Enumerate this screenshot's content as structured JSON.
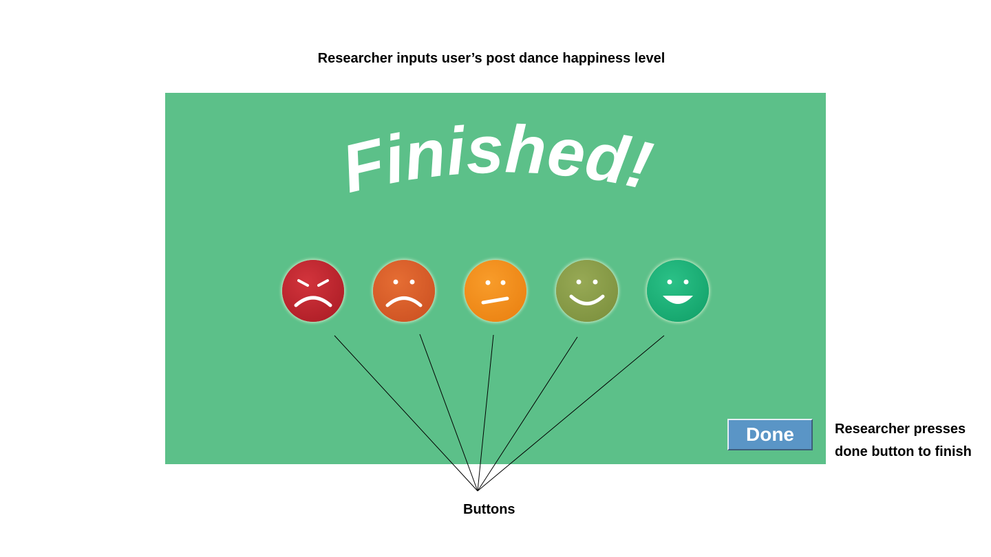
{
  "annotations": {
    "top_caption": "Researcher inputs user’s post dance happiness level",
    "done_caption_line1": "Researcher presses",
    "done_caption_line2": "done button to finish",
    "buttons_caption": "Buttons"
  },
  "screen": {
    "background_color": "#5cc089",
    "title": "Finished!",
    "done_label": "Done",
    "rating_faces": [
      {
        "mood": "angry",
        "color": "#c3262f",
        "icon": "angry-face-icon"
      },
      {
        "mood": "sad",
        "color": "#dd5f2b",
        "icon": "sad-face-icon"
      },
      {
        "mood": "neutral",
        "color": "#f4901e",
        "icon": "neutral-face-icon"
      },
      {
        "mood": "happy",
        "color": "#8b9e4a",
        "icon": "happy-face-icon"
      },
      {
        "mood": "very-happy",
        "color": "#1fb57a",
        "icon": "very-happy-face-icon"
      }
    ]
  }
}
